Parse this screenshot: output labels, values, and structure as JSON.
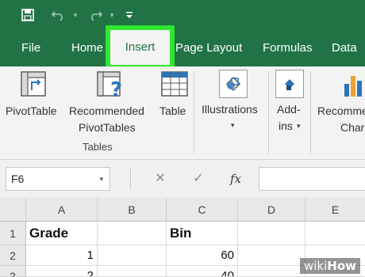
{
  "quick_access": {
    "save_icon": "save-icon",
    "undo_icon": "undo-icon",
    "redo_icon": "redo-icon",
    "customize_icon": "customize-toolbar-icon"
  },
  "tabs": [
    "File",
    "Home",
    "Insert",
    "Page Layout",
    "Formulas",
    "Data"
  ],
  "active_tab": "Insert",
  "ribbon": {
    "pivottable": "PivotTable",
    "recommended_line1": "Recommended",
    "recommended_line2": "PivotTables",
    "table": "Table",
    "tables_group": "Tables",
    "illustrations": "Illustrations",
    "addins_line1": "Add-",
    "addins_line2": "ins",
    "recommended_charts_line1": "Recomme",
    "recommended_charts_line2": "Char"
  },
  "formula_bar": {
    "name_box": "F6",
    "fx": "fx",
    "formula": ""
  },
  "grid": {
    "columns": [
      "A",
      "B",
      "C",
      "D",
      "E"
    ],
    "rows": [
      {
        "num": "1",
        "A": "Grade",
        "B": "",
        "C": "Bin",
        "D": "",
        "E": ""
      },
      {
        "num": "2",
        "A": "1",
        "B": "",
        "C": "60",
        "D": "",
        "E": ""
      },
      {
        "num": "3",
        "A": "2",
        "B": "",
        "C": "40",
        "D": "",
        "E": ""
      }
    ]
  },
  "watermark": {
    "prefix": "wiki",
    "suffix": "How"
  },
  "colors": {
    "excel_green": "#217346",
    "highlight": "#30e62f",
    "ribbon_bg": "#f3f3f3"
  }
}
